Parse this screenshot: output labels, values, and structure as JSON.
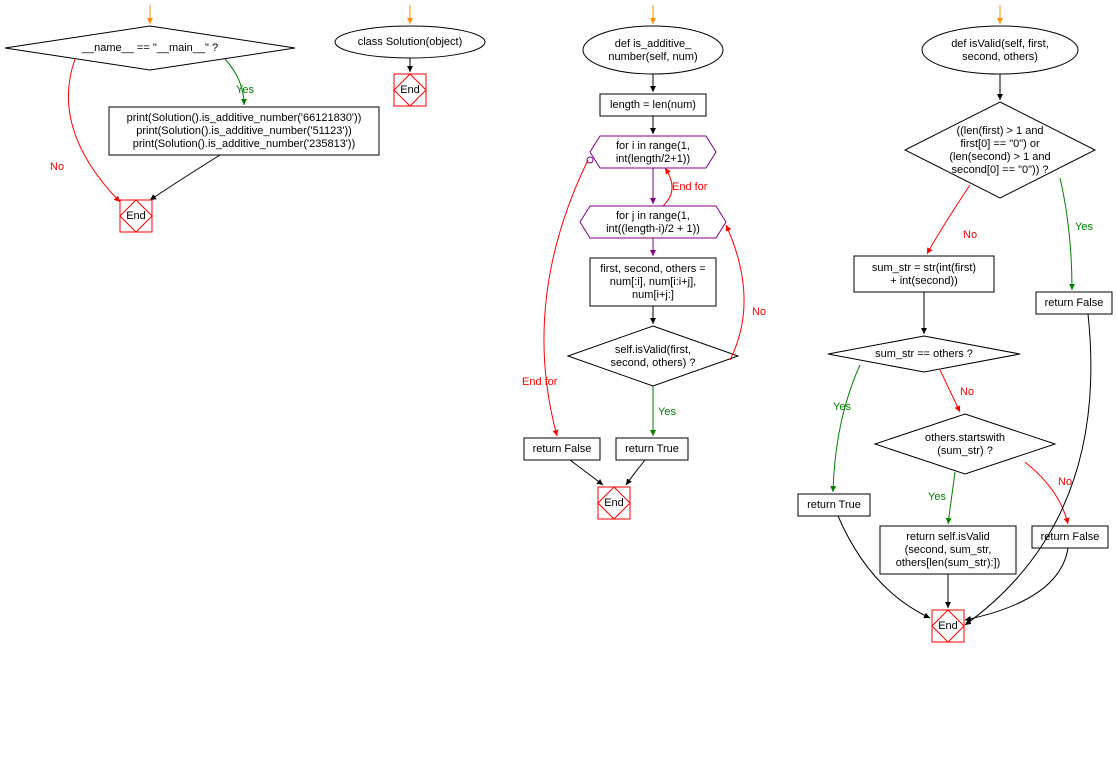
{
  "flowchart": {
    "column1": {
      "decision1": "__name__ == \"__main__\" ?",
      "process1_line1": "print(Solution().is_additive_number('66121830'))",
      "process1_line2": "print(Solution().is_additive_number('51123'))",
      "process1_line3": "print(Solution().is_additive_number('235813'))",
      "end1": "End",
      "end2": "End",
      "classdef": "class Solution(object)"
    },
    "column2": {
      "funcdef_line1": "def is_additive_",
      "funcdef_line2": "number(self, num)",
      "process1": "length = len(num)",
      "loop1_line1": "for i in range(1,",
      "loop1_line2": "int(length/2+1))",
      "loop2_line1": "for j in range(1,",
      "loop2_line2": "int((length-i)/2 + 1))",
      "process2_line1": "first, second, others =",
      "process2_line2": "num[:i], num[i:i+j],",
      "process2_line3": "num[i+j:]",
      "decision1_line1": "self.isValid(first,",
      "decision1_line2": "second, others) ?",
      "return_false": "return False",
      "return_true": "return True",
      "end": "End"
    },
    "column3": {
      "funcdef_line1": "def isValid(self, first,",
      "funcdef_line2": "second, others)",
      "decision1_line1": "((len(first) > 1 and",
      "decision1_line2": "first[0] == \"0\") or",
      "decision1_line3": "(len(second) > 1 and",
      "decision1_line4": "second[0] == \"0\")) ?",
      "process1_line1": "sum_str = str(int(first)",
      "process1_line2": "+ int(second))",
      "return_false1": "return False",
      "decision2": "sum_str == others ?",
      "return_true": "return True",
      "decision3_line1": "others.startswith",
      "decision3_line2": "(sum_str) ?",
      "process2_line1": "return self.isValid",
      "process2_line2": "(second, sum_str,",
      "process2_line3": "others[len(sum_str):])",
      "return_false2": "return False",
      "end": "End"
    },
    "edge_labels": {
      "yes": "Yes",
      "no": "No",
      "endfor": "End for"
    }
  }
}
